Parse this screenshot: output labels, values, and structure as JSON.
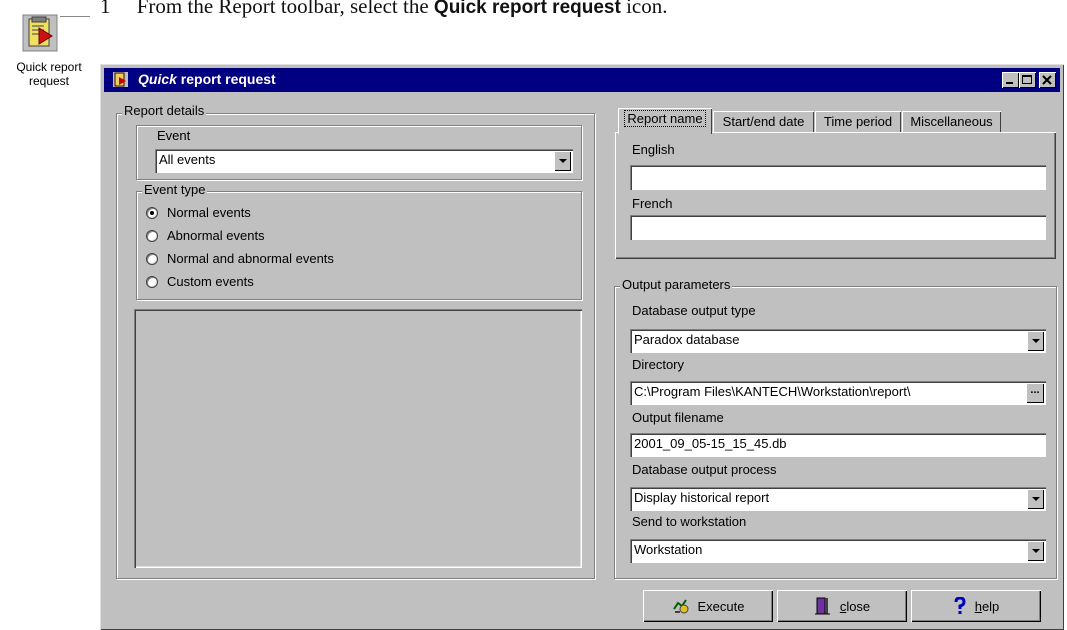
{
  "instruction": {
    "number": "1",
    "prefix": "From the Report toolbar, select the ",
    "bold": "Quick report request",
    "suffix": " icon."
  },
  "toolbar_button": {
    "label": "Quick report request",
    "icon": "quick-report-icon"
  },
  "window": {
    "title_italic": "Quick",
    "title_rest": " report request",
    "controls": [
      "minimize",
      "maximize",
      "close"
    ]
  },
  "report_details": {
    "label": "Report details",
    "event": {
      "label": "Event",
      "value": "All events"
    },
    "event_type": {
      "label": "Event type",
      "options": [
        "Normal events",
        "Abnormal events",
        "Normal and abnormal events",
        "Custom events"
      ],
      "selected": "Normal events"
    }
  },
  "tabs": [
    "Report name",
    "Start/end date",
    "Time period",
    "Miscellaneous"
  ],
  "active_tab": "Report name",
  "report_name": {
    "english_label": "English",
    "english_value": "",
    "french_label": "French",
    "french_value": ""
  },
  "output": {
    "label": "Output parameters",
    "db_type_label": "Database output type",
    "db_type_value": "Paradox database",
    "directory_label": "Directory",
    "directory_value": "C:\\Program Files\\KANTECH\\Workstation\\report\\",
    "directory_button": "...",
    "filename_label": "Output filename",
    "filename_value": "2001_09_05-15_15_45.db",
    "process_label": "Database output process",
    "process_value": "Display historical report",
    "send_label": "Send to workstation",
    "send_value": "Workstation"
  },
  "buttons": {
    "execute": "Execute",
    "close_underline": "c",
    "close_rest": "lose",
    "help_underline": "h",
    "help_rest": "elp"
  }
}
